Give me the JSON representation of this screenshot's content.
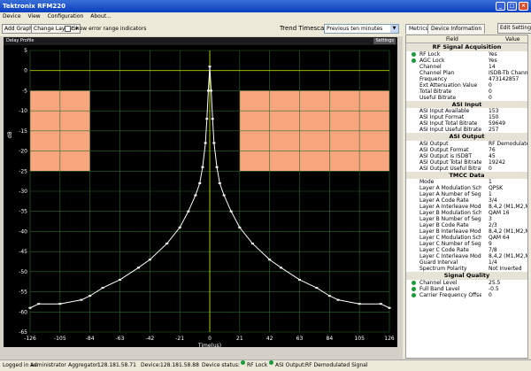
{
  "window": {
    "title": "Tektronix RFM220"
  },
  "menu": [
    "Device",
    "View",
    "Configuration",
    "About..."
  ],
  "toolbar": {
    "add_graph": "Add Graph",
    "change_layout": "Change Layout",
    "show_error_label": "Show error range indicators",
    "trend_label": "Trend Timescale:",
    "trend_value": "Previous ten minutes"
  },
  "plot": {
    "header": "Delay Profile",
    "settings": "Settings",
    "ylabel": "dB",
    "xlabel": "Time(us)",
    "colors": {
      "background": "#000000",
      "grid": "#2e6a2e",
      "trace": "#ffffff",
      "mask": "#f9a67f",
      "center": "#c8f000"
    },
    "chart_data": {
      "type": "line",
      "title": "Delay Profile",
      "xlabel": "Time(us)",
      "ylabel": "dB",
      "xlim": [
        -126,
        126
      ],
      "ylim": [
        -65,
        5
      ],
      "x_ticks": [
        -126,
        -105,
        -84,
        -63,
        -42,
        -21,
        0,
        21,
        42,
        63,
        84,
        105,
        126
      ],
      "y_ticks": [
        5,
        0,
        -5,
        -10,
        -15,
        -20,
        -25,
        -30,
        -35,
        -40,
        -45,
        -50,
        -55,
        -60,
        -65
      ],
      "grid": true,
      "series": [
        {
          "x": [
            -126,
            -120,
            -105,
            -90,
            -84,
            -75,
            -63,
            -50,
            -42,
            -30,
            -21,
            -15,
            -10,
            -7,
            -5,
            -3,
            -2,
            -1,
            0,
            1,
            2,
            3,
            5,
            7,
            10,
            15,
            21,
            30,
            42,
            50,
            63,
            75,
            84,
            90,
            105,
            120,
            126
          ],
          "y": [
            -59,
            -58,
            -58,
            -57,
            -56,
            -54,
            -52,
            -49,
            -47,
            -43,
            -39,
            -35,
            -31,
            -28,
            -24,
            -18,
            -12,
            -5,
            1,
            -5,
            -12,
            -18,
            -24,
            -28,
            -31,
            -35,
            -39,
            -43,
            -47,
            -49,
            -52,
            -54,
            -56,
            -57,
            -58,
            -58,
            -59
          ]
        }
      ],
      "masks": [
        {
          "x": [
            -126,
            -84
          ],
          "y": [
            -25,
            -5
          ]
        },
        {
          "x": [
            21,
            126
          ],
          "y": [
            -25,
            -5
          ]
        }
      ]
    }
  },
  "panel": {
    "tabs": [
      "Metrics",
      "Device Information"
    ],
    "edit_button": "Edit Settings",
    "col_field": "Field",
    "col_value": "Value",
    "sections": [
      {
        "title": "RF Signal Acquisition",
        "rows": [
          {
            "field": "RF Lock",
            "value": "Yes",
            "dot": true
          },
          {
            "field": "AGC Lock",
            "value": "Yes",
            "dot": true
          },
          {
            "field": "Channel",
            "value": "14",
            "dot": false
          },
          {
            "field": "Channel Plan",
            "value": "ISDB-Tb Chann",
            "dot": false
          },
          {
            "field": "Frequency",
            "value": "473142857",
            "dot": false
          },
          {
            "field": "Ext Attenuation Value",
            "value": "0",
            "dot": false
          },
          {
            "field": "Total Bitrate",
            "value": "0",
            "dot": false
          },
          {
            "field": "Useful Bitrate",
            "value": "0",
            "dot": false
          }
        ]
      },
      {
        "title": "ASI Input",
        "rows": [
          {
            "field": "ASI Input Available",
            "value": "153",
            "dot": false
          },
          {
            "field": "ASI Input Format",
            "value": "150",
            "dot": false
          },
          {
            "field": "ASI Input Total Bitrate",
            "value": "59649",
            "dot": false
          },
          {
            "field": "ASI Input Useful Bitrate",
            "value": "257",
            "dot": false
          }
        ]
      },
      {
        "title": "ASI Output",
        "rows": [
          {
            "field": "ASI Output",
            "value": "RF Demodulate",
            "dot": false
          },
          {
            "field": "ASI Output Format",
            "value": "76",
            "dot": false
          },
          {
            "field": "ASI Output is ISDBT",
            "value": "45",
            "dot": false
          },
          {
            "field": "ASI Output Total Bitrate",
            "value": "19242",
            "dot": false
          },
          {
            "field": "ASI Output Useful Bitrate",
            "value": "0",
            "dot": false
          }
        ]
      },
      {
        "title": "TMCC Data",
        "rows": [
          {
            "field": "Mode",
            "value": "1",
            "dot": false
          },
          {
            "field": "Layer A Modulation Scher",
            "value": "QPSK",
            "dot": false
          },
          {
            "field": "Layer A Number of Segm",
            "value": "1",
            "dot": false
          },
          {
            "field": "Layer A Code Rate",
            "value": "3/4",
            "dot": false
          },
          {
            "field": "Layer A Interleave Mode",
            "value": "8,4,2 (M1,M2,M",
            "dot": false
          },
          {
            "field": "Layer B Modulation Scher",
            "value": "QAM 16",
            "dot": false
          },
          {
            "field": "Layer B Number of Segm",
            "value": "3",
            "dot": false
          },
          {
            "field": "Layer B Code Rate",
            "value": "2/3",
            "dot": false
          },
          {
            "field": "Layer B Interleave Mode",
            "value": "8,4,2 (M1,M2,M",
            "dot": false
          },
          {
            "field": "Layer C Modulation Scher",
            "value": "QAM 64",
            "dot": false
          },
          {
            "field": "Layer C Number of Segm",
            "value": "9",
            "dot": false
          },
          {
            "field": "Layer C Code Rate",
            "value": "7/8",
            "dot": false
          },
          {
            "field": "Layer C Interleave Mode",
            "value": "8,4,2 (M1,M2,M",
            "dot": false
          },
          {
            "field": "Guard Interval",
            "value": "1/4",
            "dot": false
          },
          {
            "field": "Spectrum Polarity",
            "value": "Not Inverted",
            "dot": false
          }
        ]
      },
      {
        "title": "Signal Quality",
        "rows": [
          {
            "field": "Channel Level",
            "value": "25.5",
            "dot": true
          },
          {
            "field": "Full Band Level",
            "value": "-0.5",
            "dot": true
          },
          {
            "field": "Carrier Frequency Offset",
            "value": "0",
            "dot": true
          }
        ]
      }
    ]
  },
  "status": {
    "logged_label": "Logged in as:",
    "logged_value": "Administrator",
    "aggregator_label": "Aggregator:",
    "aggregator_value": "128.181.58.71",
    "device_label": "Device:",
    "device_value": "128.181.58.88",
    "device_status_label": "Device status:",
    "rf_lock": "RF Lock",
    "asi_label": "ASI Output:",
    "asi_value": "RF Demodulated Signal"
  }
}
